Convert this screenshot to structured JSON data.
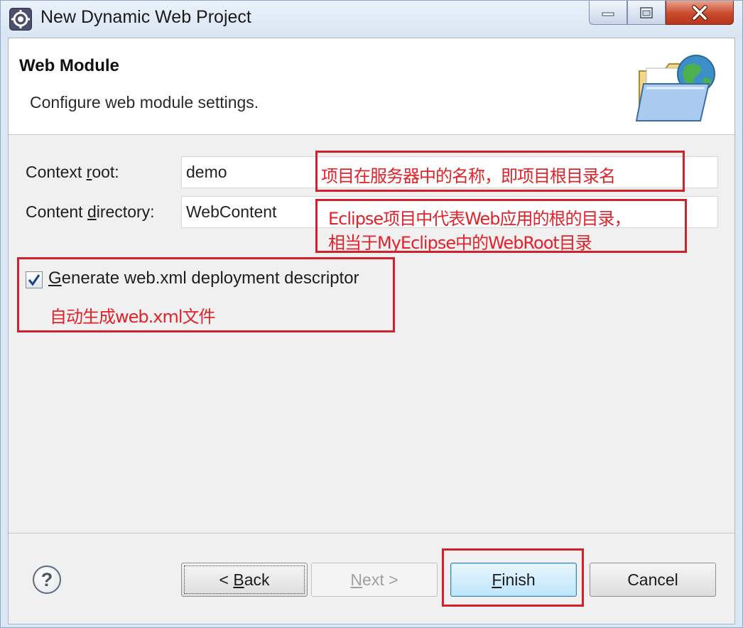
{
  "window": {
    "title": "New Dynamic Web Project",
    "controls": {
      "minimize": "minimize-icon",
      "maximize": "maximize-icon",
      "close": "close-icon"
    }
  },
  "banner": {
    "title": "Web Module",
    "subtitle": "Configure web module settings.",
    "icon": "folder-globe-icon"
  },
  "form": {
    "context_root": {
      "label_pre": "Context ",
      "label_mnemonic": "r",
      "label_post": "oot:",
      "value": "demo"
    },
    "content_directory": {
      "label_pre": "Content ",
      "label_mnemonic": "d",
      "label_post": "irectory:",
      "value": "WebContent"
    },
    "generate_xml": {
      "label_mnemonic": "G",
      "label_post": "enerate web.xml deployment descriptor",
      "checked": true
    }
  },
  "annotations": {
    "context_root_note": "项目在服务器中的名称，即项目根目录名",
    "content_dir_note_line1": "Eclipse项目中代表Web应用的根的目录，",
    "content_dir_note_line2": "相当于MyEclipse中的WebRoot目录",
    "generate_xml_note": "自动生成web.xml文件",
    "color": "#e1222a"
  },
  "buttons": {
    "help": "?",
    "back_pre": "< ",
    "back_mnemonic": "B",
    "back_post": "ack",
    "next_mnemonic": "N",
    "next_post": "ext >",
    "next_enabled": false,
    "finish_mnemonic": "F",
    "finish_post": "inish",
    "cancel": "Cancel"
  }
}
